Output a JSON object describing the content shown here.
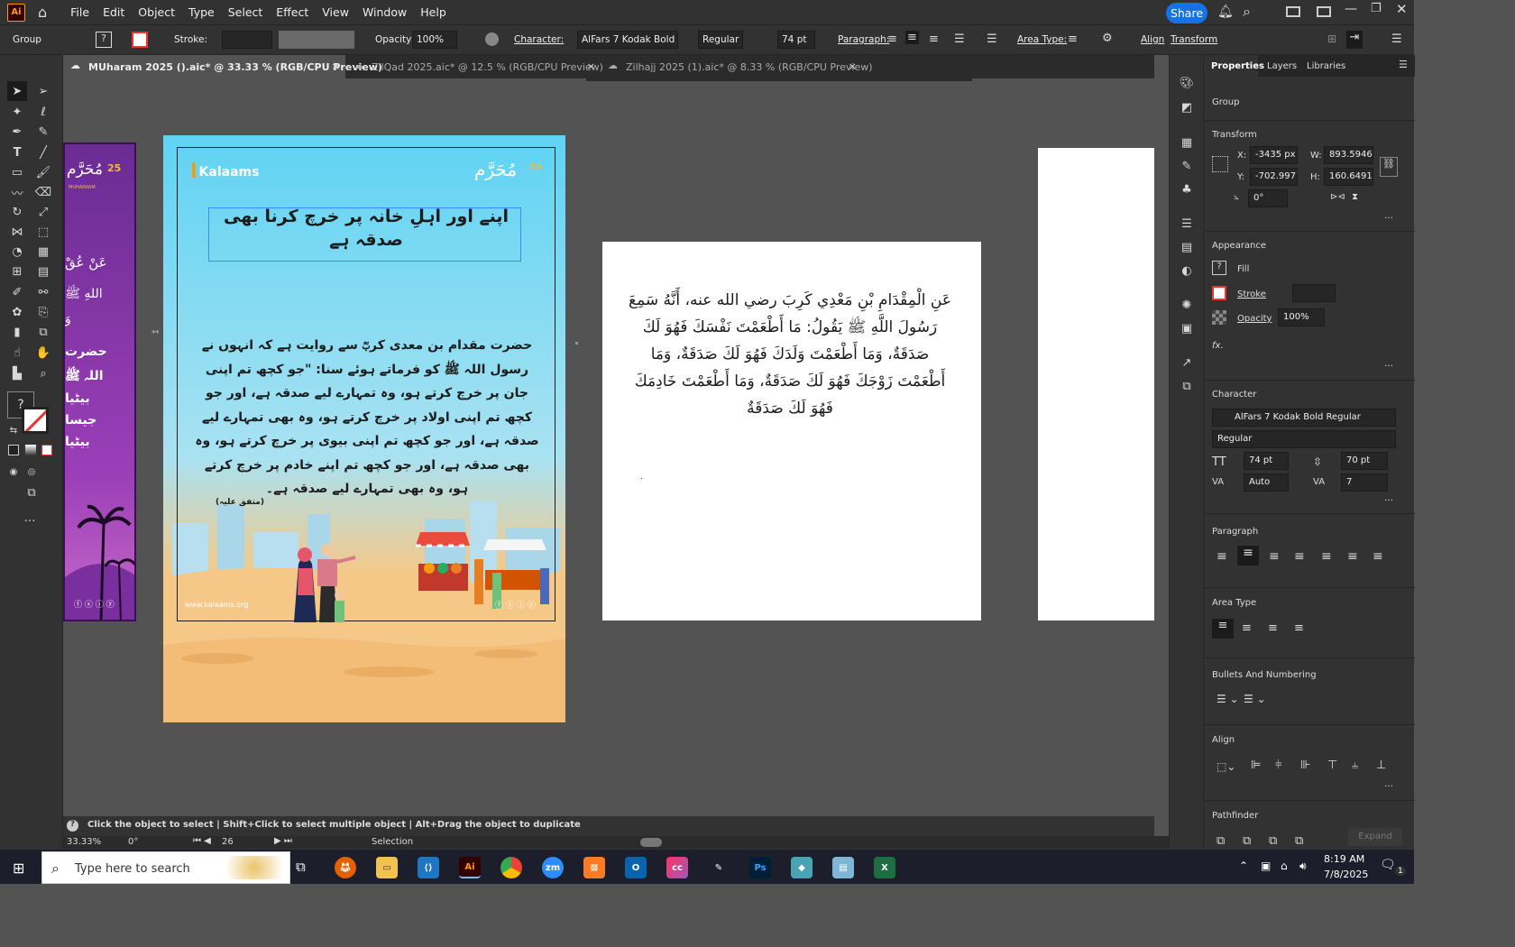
{
  "menubar": {
    "logo": "Ai",
    "items": [
      "File",
      "Edit",
      "Object",
      "Type",
      "Select",
      "Effect",
      "View",
      "Window",
      "Help"
    ],
    "share": "Share"
  },
  "control": {
    "selection": "Group",
    "stroke_label": "Stroke:",
    "opacity_label": "Opacity:",
    "opacity_value": "100%",
    "character_label": "Character:",
    "font": "AlFars 7 Kodak Bold Re...",
    "style": "Regular",
    "size": "74 pt",
    "paragraph_label": "Paragraph:",
    "area_type_label": "Area Type:",
    "align_label": "Align",
    "transform_label": "Transform"
  },
  "tabs": [
    {
      "label": "MUharam 2025 ().aic* @ 33.33 % (RGB/CPU Preview)",
      "close": "×"
    },
    {
      "label": "ZilQad 2025.aic* @ 12.5 % (RGB/CPU Preview)",
      "close": "×"
    },
    {
      "label": "Zilhajj 2025 (1).aic* @ 8.33 % (RGB/CPU Preview)",
      "close": "×"
    }
  ],
  "artboard_main": {
    "brand": "Kalaams",
    "logo_text": "مُحَرَّم",
    "logo_number": "25",
    "title": "اپنے اور اہلِ خانہ پر خرچ کرنا بھی صدقہ ہے",
    "body": "حضرت مقدام بن معدی کربؓ سے روایت ہے کہ انہوں نے رسول اللہ ﷺ کو فرماتے ہوئے سنا: \"جو کچھ تم اپنی جان پر خرچ کرتے ہو، وہ تمہارے لیے صدقہ ہے، اور جو کچھ تم اپنی اولاد پر خرچ کرتے ہو، وہ بھی تمہارے لیے صدقہ ہے، اور جو کچھ تم اپنی بیوی پر خرچ کرتے ہو، وہ بھی صدقہ ہے، اور جو کچھ تم اپنے خادم پر خرچ کرتے ہو، وہ بھی تمہارے لیے صدقہ ہے۔",
    "source": "(متفق علیہ)",
    "website": "www.kalaams.org"
  },
  "artboard_left": {
    "logo_text": "مُحَرَّم",
    "logo_number": "25",
    "sub": "MUHARRAM",
    "lines": [
      "عَنْ عُقْ",
      "اللهِ ﷺ",
      "وَ",
      "حضرت",
      "اللہ ﷺ",
      "بیٹیا",
      "جیسا",
      "بیٹیا"
    ]
  },
  "artboard_arabic": {
    "text": "عَنِ الْمِقْدَامِ بْنِ مَعْدِي كَرِبَ رضي الله عنه، أَنَّهُ سَمِعَ رَسُولَ اللَّهِ ﷺ يَقُولُ: مَا أَطْعَمْتَ نَفْسَكَ فَهُوَ لَكَ صَدَقَةٌ، وَمَا أَطْعَمْتَ وَلَدَكَ فَهُوَ لَكَ صَدَقَةٌ، وَمَا أَطْعَمْتَ زَوْجَكَ فَهُوَ لَكَ صَدَقَةٌ، وَمَا أَطْعَمْتَ خَادِمَكَ فَهُوَ لَكَ صَدَقَةٌ",
    "dot": "."
  },
  "properties": {
    "tabs": [
      "Properties",
      "Layers",
      "Libraries"
    ],
    "selection": "Group",
    "transform_title": "Transform",
    "x_label": "X:",
    "x": "-3435 px",
    "w_label": "W:",
    "w": "893.5946 p",
    "y_label": "Y:",
    "y": "-702.9977",
    "h_label": "H:",
    "h": "160.6491 p",
    "angle": "0°",
    "appearance_title": "Appearance",
    "fill_label": "Fill",
    "stroke_label": "Stroke",
    "opacity_label": "Opacity",
    "opacity": "100%",
    "fx": "fx.",
    "character_title": "Character",
    "font": "AlFars 7 Kodak Bold Regular",
    "style": "Regular",
    "size": "74 pt",
    "leading": "70 pt",
    "kerning": "Auto",
    "tracking": "7",
    "paragraph_title": "Paragraph",
    "area_type_title": "Area Type",
    "bullets_title": "Bullets And Numbering",
    "align_title": "Align",
    "pathfinder_title": "Pathfinder",
    "expand": "Expand"
  },
  "status": {
    "hint": "Click the object to select  |  Shift+Click to select multiple object  |  Alt+Drag the object to duplicate",
    "zoom": "33.33%",
    "rotate": "0°",
    "artboard": "26",
    "mode": "Selection"
  },
  "taskbar": {
    "search_placeholder": "Type here to search",
    "time": "8:19 AM",
    "date": "7/8/2025",
    "notif": "1"
  },
  "colors": {
    "accent": "#1473e6",
    "artboard_bg": "#5fd3f3",
    "purple": "#7a2f9e",
    "sand": "#f6c887"
  }
}
